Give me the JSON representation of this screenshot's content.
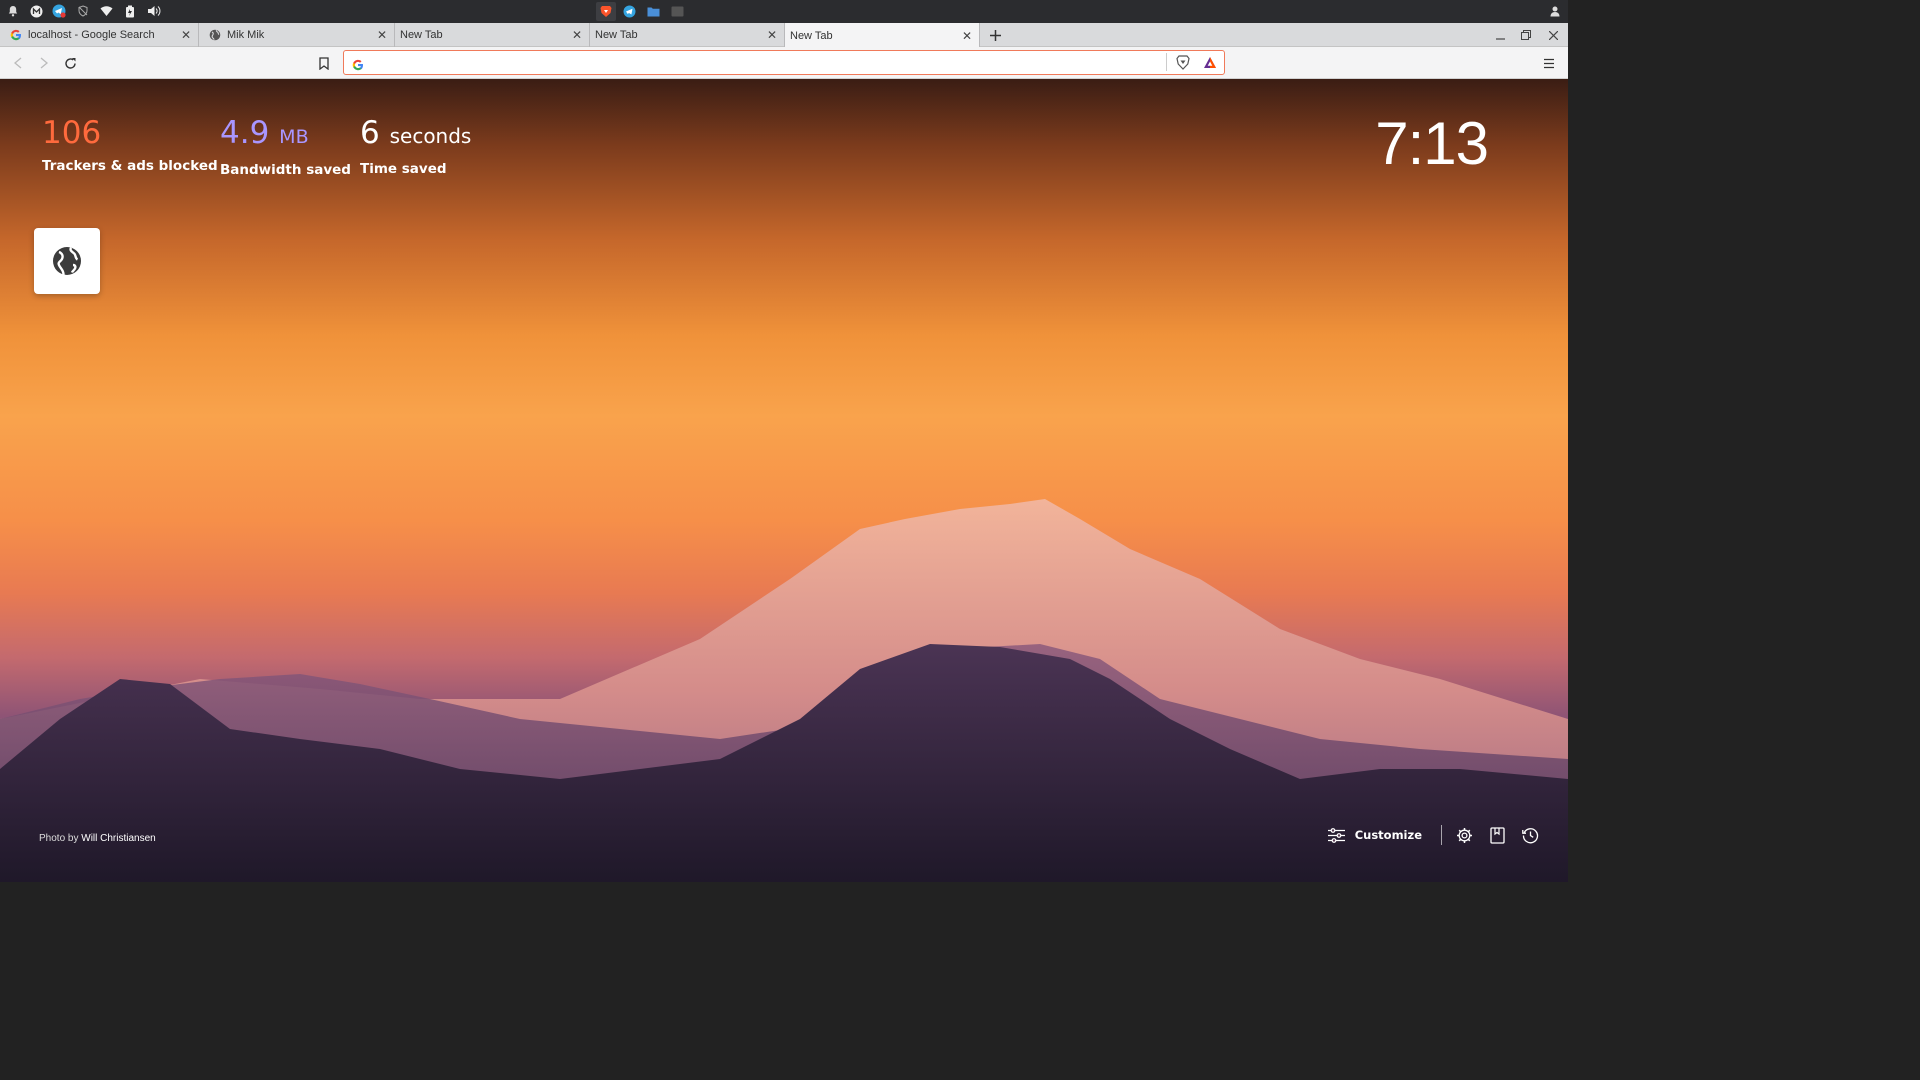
{
  "tabs": [
    {
      "title": "localhost - Google Search",
      "favicon": "google-g-icon",
      "active": false
    },
    {
      "title": "Mik Mik",
      "favicon": "globe-icon",
      "active": false
    },
    {
      "title": "New Tab",
      "favicon": "",
      "active": false
    },
    {
      "title": "New Tab",
      "favicon": "",
      "active": false
    },
    {
      "title": "New Tab",
      "favicon": "",
      "active": true
    }
  ],
  "address_bar": {
    "value": "",
    "search_engine_icon": "google-g-icon"
  },
  "stats": {
    "trackers": {
      "value": "106",
      "label": "Trackers & ads blocked",
      "color": "#ff6a3d"
    },
    "bandwidth": {
      "value": "4.9",
      "unit": "MB",
      "label": "Bandwidth saved",
      "color": "#a996ff"
    },
    "time": {
      "value": "6",
      "unit": "seconds",
      "label": "Time saved",
      "color": "#ffffff"
    }
  },
  "clock": "7:13",
  "top_site": {
    "icon": "globe-icon"
  },
  "credit": {
    "prefix": "Photo by",
    "author": "Will Christiansen"
  },
  "bottom": {
    "customize_label": "Customize"
  },
  "colors": {
    "accent": "#fb542b",
    "urlbar_border": "#f07a5a"
  }
}
